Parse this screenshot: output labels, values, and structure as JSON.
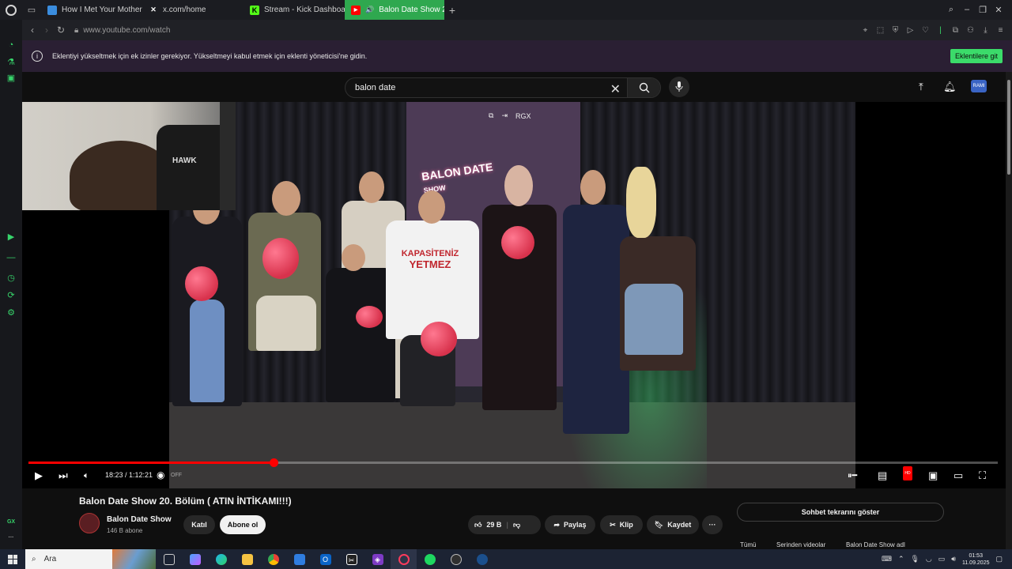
{
  "browser": {
    "tabs": [
      {
        "label": "How I Met Your Mother 8.",
        "icon_color": "#3a8dde"
      },
      {
        "label": "x.com/home",
        "icon_color": "#ffffff"
      },
      {
        "label": "Stream - Kick Dashboard",
        "icon_color": "#53fc18"
      },
      {
        "label": "Balon Date Show 20.",
        "icon_color": "#ff0000"
      }
    ],
    "new_tab_label": "+",
    "url": "www.youtube.com/watch",
    "accent_color": "#2fa84f"
  },
  "sidebar": {
    "bottom_label": "GX",
    "more_label": "···"
  },
  "banner": {
    "message": "Eklentiyi yükseltmek için ek izinler gerekiyor. Yükseltmeyi kabul etmek için eklenti yöneticisi'ne gidin.",
    "button_label": "Eklentilere git"
  },
  "youtube_header": {
    "search_value": "balon date",
    "avatar_label": "RAMI"
  },
  "video": {
    "overlay_label": "RGX",
    "shirt_line1": "KAPASİTENİZ",
    "shirt_line2": "YETMEZ",
    "sign_text": "BALON DATE",
    "sign_sub": "SHOW",
    "chair_brand": "HAWK",
    "progress_fraction": 0.253
  },
  "player_controls": {
    "time": "18:23 / 1:12:21",
    "autoplay_state": "OFF",
    "hd_label": "HD"
  },
  "details": {
    "title": "Balon Date Show 20. Bölüm ( ATIN İNTİKAMI!!!)",
    "channel_name": "Balon Date Show",
    "subscribers": "146 B abone",
    "join_label": "Katıl",
    "subscribe_label": "Abone ol",
    "likes": "29 B",
    "share_label": "Paylaş",
    "clip_label": "Klip",
    "save_label": "Kaydet",
    "more_label": "···",
    "chat_button": "Sohbet tekrarını göster",
    "chips": [
      "Tümü",
      "Serinden videolar",
      "Balon Date Show adl"
    ]
  },
  "taskbar": {
    "search_label": "Ara",
    "time": "01:53",
    "date": "11.09.2025"
  }
}
